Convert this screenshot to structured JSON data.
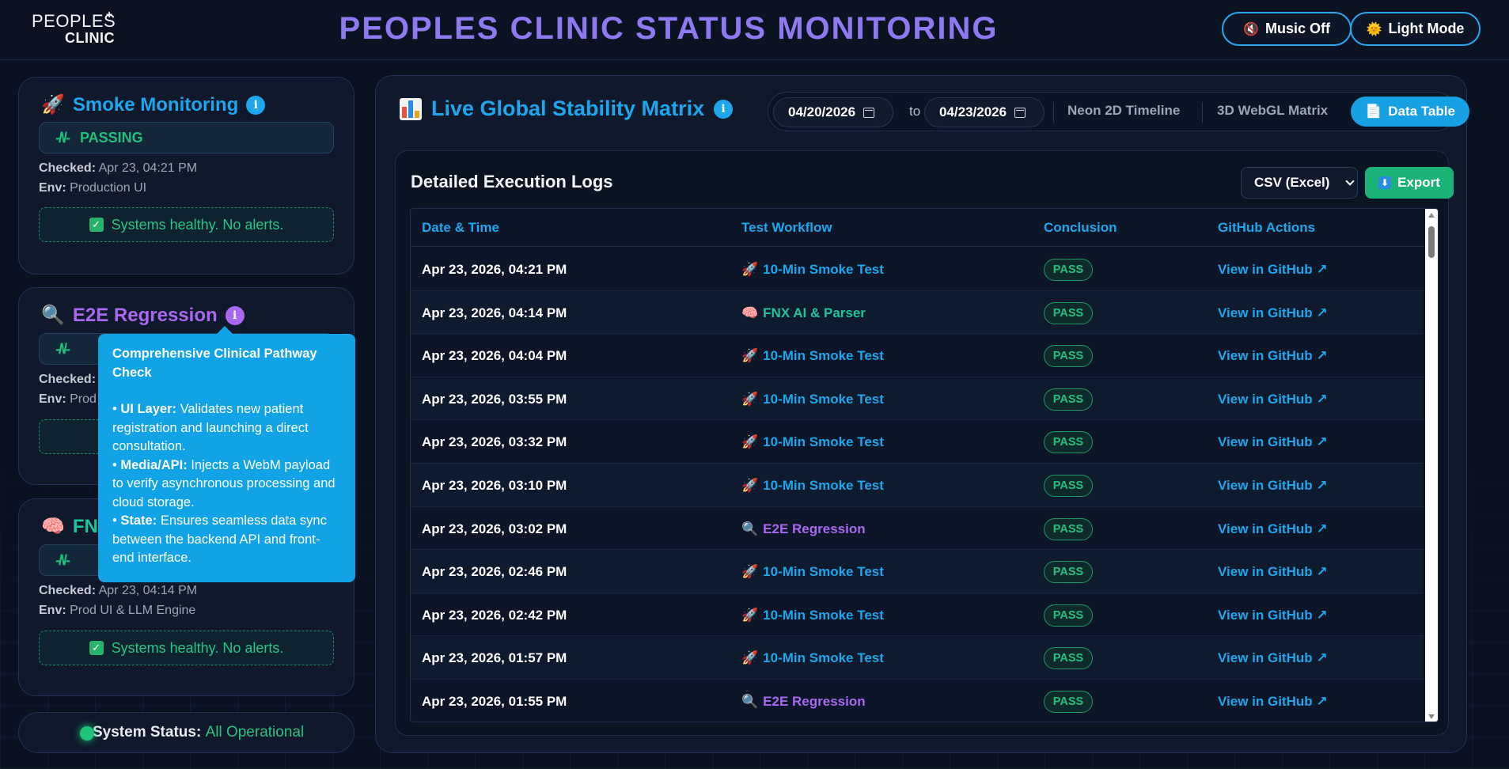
{
  "header": {
    "logo_line1": "PEOPLES",
    "logo_line2": "CLINIC",
    "title": "PEOPLES CLINIC STATUS MONITORING",
    "music_btn": "Music Off",
    "theme_btn": "Light Mode"
  },
  "cards": [
    {
      "title": "Smoke Monitoring",
      "emoji": "🚀",
      "color": "#1ea6ec",
      "status": "PASSING",
      "checked_label": "Checked:",
      "checked": "Apr 23, 04:21 PM",
      "env_label": "Env:",
      "env": "Production UI",
      "healthy": "Systems healthy. No alerts."
    },
    {
      "title": "E2E Regression",
      "emoji": "🔍",
      "color": "#a968f0",
      "checked_label": "Checked:",
      "env_label": "Env:",
      "env": "Prod"
    },
    {
      "title": "FNX",
      "emoji": "🧠",
      "color": "#1ec59a",
      "checked_label": "Checked:",
      "checked": "Apr 23, 04:14 PM",
      "env_label": "Env:",
      "env": "Prod UI & LLM Engine",
      "healthy": "Systems healthy. No alerts."
    }
  ],
  "tooltip": {
    "title": "Comprehensive Clinical Pathway Check",
    "items": [
      {
        "label": "UI Layer:",
        "text": "Validates new patient registration and launching a direct consultation."
      },
      {
        "label": "Media/API:",
        "text": "Injects a WebM payload to verify asynchronous processing and cloud storage."
      },
      {
        "label": "State:",
        "text": "Ensures seamless data sync between the backend API and front-end interface."
      }
    ]
  },
  "system_status": {
    "label": "System Status:",
    "value": "All Operational"
  },
  "main": {
    "title": "Live Global Stability Matrix",
    "date_from": "04/20/2026",
    "date_to_label": "to",
    "date_to": "04/23/2026",
    "view_tabs": [
      "Neon 2D Timeline",
      "3D WebGL Matrix",
      "Data Table"
    ],
    "active_tab": "Data Table",
    "logs_title": "Detailed Execution Logs",
    "export_format": "CSV (Excel)",
    "export_btn": "Export",
    "columns": [
      "Date & Time",
      "Test Workflow",
      "Conclusion",
      "GitHub Actions"
    ],
    "rows": [
      {
        "date": "Apr 23, 2026, 04:21 PM",
        "workflow": "10-Min Smoke Test",
        "type": "smoke",
        "conclusion": "PASS",
        "action": "View in GitHub ↗"
      },
      {
        "date": "Apr 23, 2026, 04:14 PM",
        "workflow": "FNX AI & Parser",
        "type": "fnx",
        "conclusion": "PASS",
        "action": "View in GitHub ↗"
      },
      {
        "date": "Apr 23, 2026, 04:04 PM",
        "workflow": "10-Min Smoke Test",
        "type": "smoke",
        "conclusion": "PASS",
        "action": "View in GitHub ↗"
      },
      {
        "date": "Apr 23, 2026, 03:55 PM",
        "workflow": "10-Min Smoke Test",
        "type": "smoke",
        "conclusion": "PASS",
        "action": "View in GitHub ↗"
      },
      {
        "date": "Apr 23, 2026, 03:32 PM",
        "workflow": "10-Min Smoke Test",
        "type": "smoke",
        "conclusion": "PASS",
        "action": "View in GitHub ↗"
      },
      {
        "date": "Apr 23, 2026, 03:10 PM",
        "workflow": "10-Min Smoke Test",
        "type": "smoke",
        "conclusion": "PASS",
        "action": "View in GitHub ↗"
      },
      {
        "date": "Apr 23, 2026, 03:02 PM",
        "workflow": "E2E Regression",
        "type": "e2e",
        "conclusion": "PASS",
        "action": "View in GitHub ↗"
      },
      {
        "date": "Apr 23, 2026, 02:46 PM",
        "workflow": "10-Min Smoke Test",
        "type": "smoke",
        "conclusion": "PASS",
        "action": "View in GitHub ↗"
      },
      {
        "date": "Apr 23, 2026, 02:42 PM",
        "workflow": "10-Min Smoke Test",
        "type": "smoke",
        "conclusion": "PASS",
        "action": "View in GitHub ↗"
      },
      {
        "date": "Apr 23, 2026, 01:57 PM",
        "workflow": "10-Min Smoke Test",
        "type": "smoke",
        "conclusion": "PASS",
        "action": "View in GitHub ↗"
      },
      {
        "date": "Apr 23, 2026, 01:55 PM",
        "workflow": "E2E Regression",
        "type": "e2e",
        "conclusion": "PASS",
        "action": "View in GitHub ↗"
      }
    ]
  },
  "colors": {
    "accent_blue": "#1ea6ec",
    "accent_purple": "#8d7af0",
    "pass_green": "#22c080",
    "e2e_purple": "#a968f0"
  },
  "icons": {
    "smoke": "🚀",
    "fnx": "🧠",
    "e2e": "🔍"
  }
}
